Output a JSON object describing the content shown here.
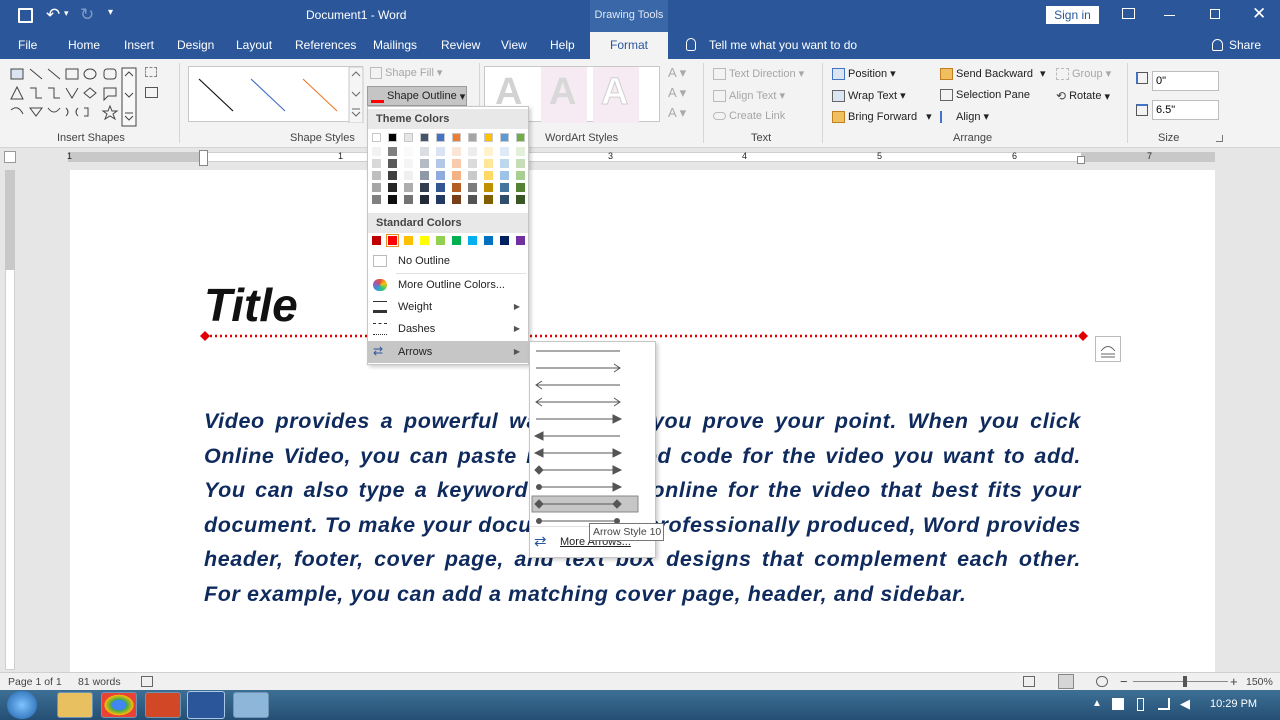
{
  "titlebar": {
    "doc_title": "Document1  -  Word",
    "context_label": "Drawing Tools",
    "sign_in": "Sign in"
  },
  "tabs": [
    "File",
    "Home",
    "Insert",
    "Design",
    "Layout",
    "References",
    "Mailings",
    "Review",
    "View",
    "Help"
  ],
  "active_tab": "Format",
  "tell_me": "Tell me what you want to do",
  "share": "Share",
  "ribbon": {
    "groups": {
      "insert_shapes": "Insert Shapes",
      "shape_styles": "Shape Styles",
      "wordart_styles": "WordArt Styles",
      "text": "Text",
      "arrange": "Arrange",
      "size": "Size"
    },
    "shape_fill": "Shape Fill",
    "shape_outline": "Shape Outline",
    "text_direction": "Text Direction",
    "align_text": "Align Text",
    "create_link": "Create Link",
    "position": "Position",
    "wrap_text": "Wrap Text",
    "bring_forward": "Bring Forward",
    "send_backward": "Send Backward",
    "selection_pane": "Selection Pane",
    "group": "Group",
    "rotate": "Rotate",
    "align": "Align",
    "height": "0\"",
    "width": "6.5\""
  },
  "ruler_numbers": [
    "1",
    "1",
    "2",
    "3",
    "4",
    "5",
    "6",
    "7"
  ],
  "document": {
    "title": "Title",
    "body": "Video provides a powerful way to help you prove your point. When you click Online Video, you can paste in the embed code for the video you want to add. You can also type a keyword to search online for the video that best fits your document. To make your document look professionally produced, Word provides header, footer, cover page, and text box designs that complement each other. For example, you can add a matching cover page, header, and sidebar."
  },
  "outline_menu": {
    "theme_colors": "Theme Colors",
    "standard_colors": "Standard Colors",
    "theme_top": [
      "#ffffff",
      "#000000",
      "#e7e6e6",
      "#44546a",
      "#4472c4",
      "#ed7d31",
      "#a5a5a5",
      "#ffc000",
      "#5b9bd5",
      "#70ad47"
    ],
    "standard": [
      "#c00000",
      "#ff0000",
      "#ffc000",
      "#ffff00",
      "#92d050",
      "#00b050",
      "#00b0f0",
      "#0070c0",
      "#002060",
      "#7030a0"
    ],
    "no_outline": "No Outline",
    "more_colors": "More Outline Colors...",
    "weight": "Weight",
    "dashes": "Dashes",
    "arrows": "Arrows"
  },
  "arrows_menu": {
    "more_arrows": "More Arrows...",
    "tooltip": "Arrow Style 10"
  },
  "status": {
    "page": "Page 1 of 1",
    "words": "81 words",
    "zoom": "150%"
  },
  "taskbar": {
    "time": "10:29 PM"
  }
}
